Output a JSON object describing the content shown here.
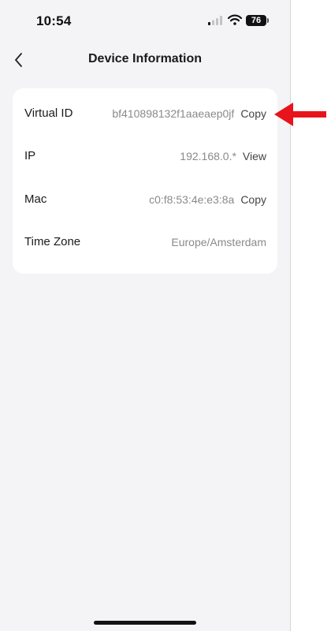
{
  "status_bar": {
    "time": "10:54",
    "battery": "76"
  },
  "header": {
    "title": "Device Information"
  },
  "rows": [
    {
      "label": "Virtual ID",
      "value": "bf410898132f1aaeaep0jf",
      "action": "Copy"
    },
    {
      "label": "IP",
      "value": "192.168.0.*",
      "action": "View"
    },
    {
      "label": "Mac",
      "value": "c0:f8:53:4e:e3:8a",
      "action": "Copy"
    },
    {
      "label": "Time Zone",
      "value": "Europe/Amsterdam",
      "action": ""
    }
  ],
  "colors": {
    "annotation_arrow": "#e8141c",
    "background": "#f4f4f6",
    "card": "#ffffff"
  }
}
